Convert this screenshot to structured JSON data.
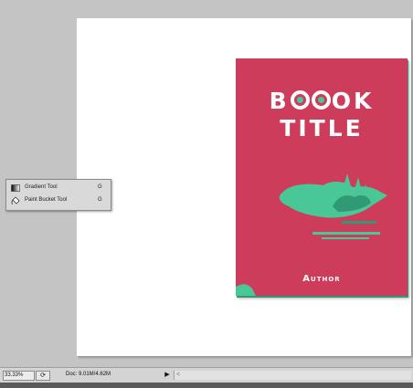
{
  "document": {
    "book": {
      "title_line1_pre": "B",
      "title_line1_post": "OK",
      "title_line2": "TITLE",
      "author": "Author"
    }
  },
  "tool_flyout": {
    "items": [
      {
        "icon": "gradient-icon",
        "label": "Gradient Tool",
        "shortcut": "G"
      },
      {
        "icon": "paint-bucket-icon",
        "label": "Paint Bucket Tool",
        "shortcut": "G"
      }
    ]
  },
  "status_bar": {
    "zoom": "33.33%",
    "doc_info": "Doc: 9.01M/4.62M",
    "nav_glyph": "▶",
    "scroll_glyph": "<"
  },
  "colors": {
    "workspace": "#c4c4c4",
    "cover": "#cd3c5a",
    "accent_green": "#49c796",
    "title": "#ffffff"
  }
}
